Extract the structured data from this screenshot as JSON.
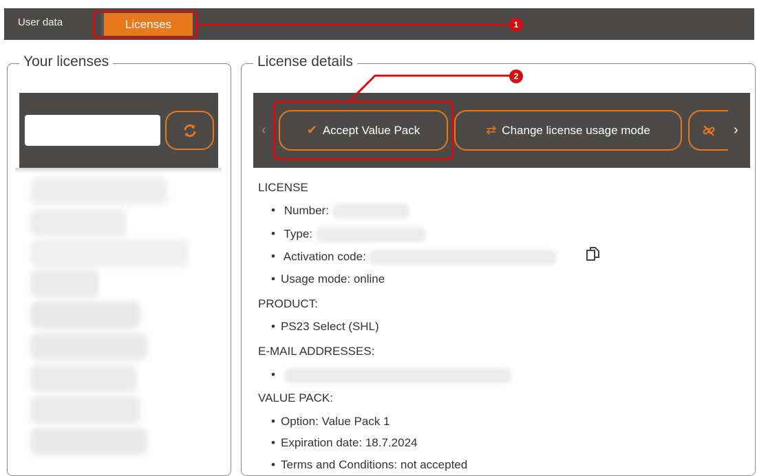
{
  "tabs": {
    "user_data": "User data",
    "licenses": "Licenses"
  },
  "annotations": {
    "callout_1": "1",
    "callout_2": "2"
  },
  "left_panel": {
    "title": "Your licenses",
    "search_value": "",
    "refresh_icon": "refresh-icon"
  },
  "right_panel": {
    "title": "License details",
    "toolbar": {
      "accept_label": "Accept Value Pack",
      "accept_icon": "check-icon",
      "change_label": "Change license usage mode",
      "change_icon": "swap-icon",
      "third_icon": "unlink-icon"
    },
    "license": {
      "heading": "LICENSE",
      "number_label": "Number:",
      "type_label": "Type:",
      "activation_label": "Activation code:",
      "usage_mode": "Usage mode: online"
    },
    "product": {
      "heading": "PRODUCT:",
      "item": "PS23 Select (SHL)"
    },
    "email": {
      "heading": "E-MAIL ADDRESSES:"
    },
    "value_pack": {
      "heading": "VALUE PACK:",
      "option": "Option: Value Pack 1",
      "expiration": "Expiration date: 18.7.2024",
      "terms": "Terms and Conditions: not accepted"
    }
  },
  "colors": {
    "accent": "#e9781d",
    "bar": "#4b4a48",
    "callout": "#d31010"
  }
}
